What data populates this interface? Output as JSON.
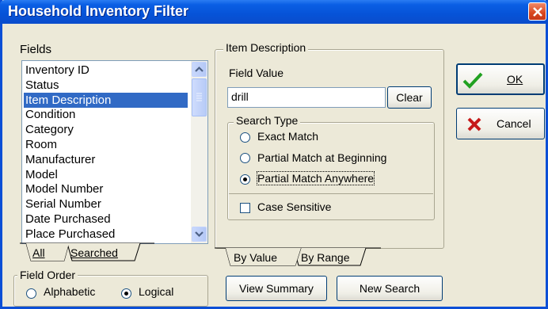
{
  "window": {
    "title": "Household Inventory Filter"
  },
  "fields": {
    "label": "Fields",
    "items": [
      "Inventory ID",
      "Status",
      "Item Description",
      "Condition",
      "Category",
      "Room",
      "Manufacturer",
      "Model",
      "Model Number",
      "Serial Number",
      "Date Purchased",
      "Place Purchased"
    ],
    "selected": "Item Description",
    "tabs": [
      "All",
      "Searched"
    ]
  },
  "field_order": {
    "label": "Field Order",
    "options": [
      "Alphabetic",
      "Logical"
    ],
    "selected": "Logical"
  },
  "item_description": {
    "group_label": "Item Description",
    "field_value_label": "Field Value",
    "field_value": "drill",
    "clear_label": "Clear",
    "search_type": {
      "label": "Search Type",
      "options": [
        "Exact Match",
        "Partial Match at Beginning",
        "Partial Match Anywhere"
      ],
      "selected": "Partial Match Anywhere"
    },
    "case_sensitive_label": "Case Sensitive",
    "case_sensitive": false,
    "tabs": [
      "By Value",
      "By Range"
    ]
  },
  "buttons": {
    "ok": "OK",
    "cancel": "Cancel",
    "view_summary": "View Summary",
    "new_search": "New Search"
  },
  "colors": {
    "titlebar": "#0653d8",
    "selection": "#316ac5",
    "ok_check": "#21a121",
    "cancel_x": "#c61a1a"
  }
}
